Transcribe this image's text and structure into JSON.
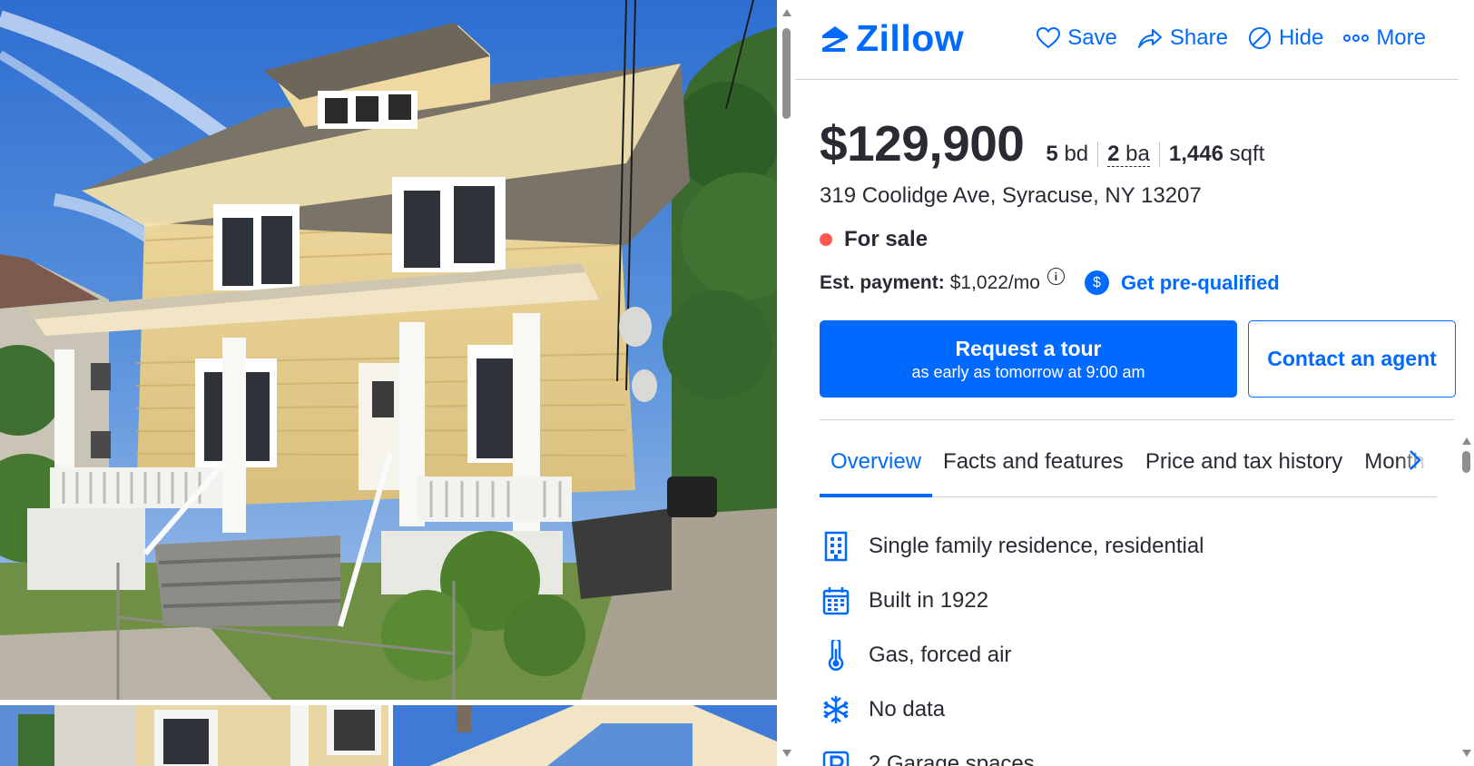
{
  "brand": {
    "name": "Zillow",
    "color": "#006aff"
  },
  "actions": [
    {
      "label": "Save",
      "icon": "heart-icon"
    },
    {
      "label": "Share",
      "icon": "share-icon"
    },
    {
      "label": "Hide",
      "icon": "hide-icon"
    },
    {
      "label": "More",
      "icon": "more-icon"
    }
  ],
  "listing": {
    "price": "$129,900",
    "beds_num": "5",
    "beds_unit": "bd",
    "baths_num": "2",
    "baths_unit": "ba",
    "sqft_num": "1,446",
    "sqft_unit": "sqft",
    "address": "319 Coolidge Ave, Syracuse, NY 13207",
    "status": "For sale",
    "status_color": "#ff5a4f",
    "payment_label": "Est. payment:",
    "payment_value": "$1,022/mo",
    "prequal_label": "Get pre-qualified"
  },
  "cta": {
    "tour_main": "Request a tour",
    "tour_sub": "as early as tomorrow at 9:00 am",
    "contact": "Contact an agent"
  },
  "tabs": [
    "Overview",
    "Facts and features",
    "Price and tax history",
    "Month"
  ],
  "features": [
    {
      "icon": "building-icon",
      "text": "Single family residence, residential"
    },
    {
      "icon": "calendar-icon",
      "text": "Built in 1922"
    },
    {
      "icon": "thermometer-icon",
      "text": "Gas, forced air"
    },
    {
      "icon": "snowflake-icon",
      "text": "No data"
    },
    {
      "icon": "parking-icon",
      "text": "2 Garage spaces"
    }
  ]
}
